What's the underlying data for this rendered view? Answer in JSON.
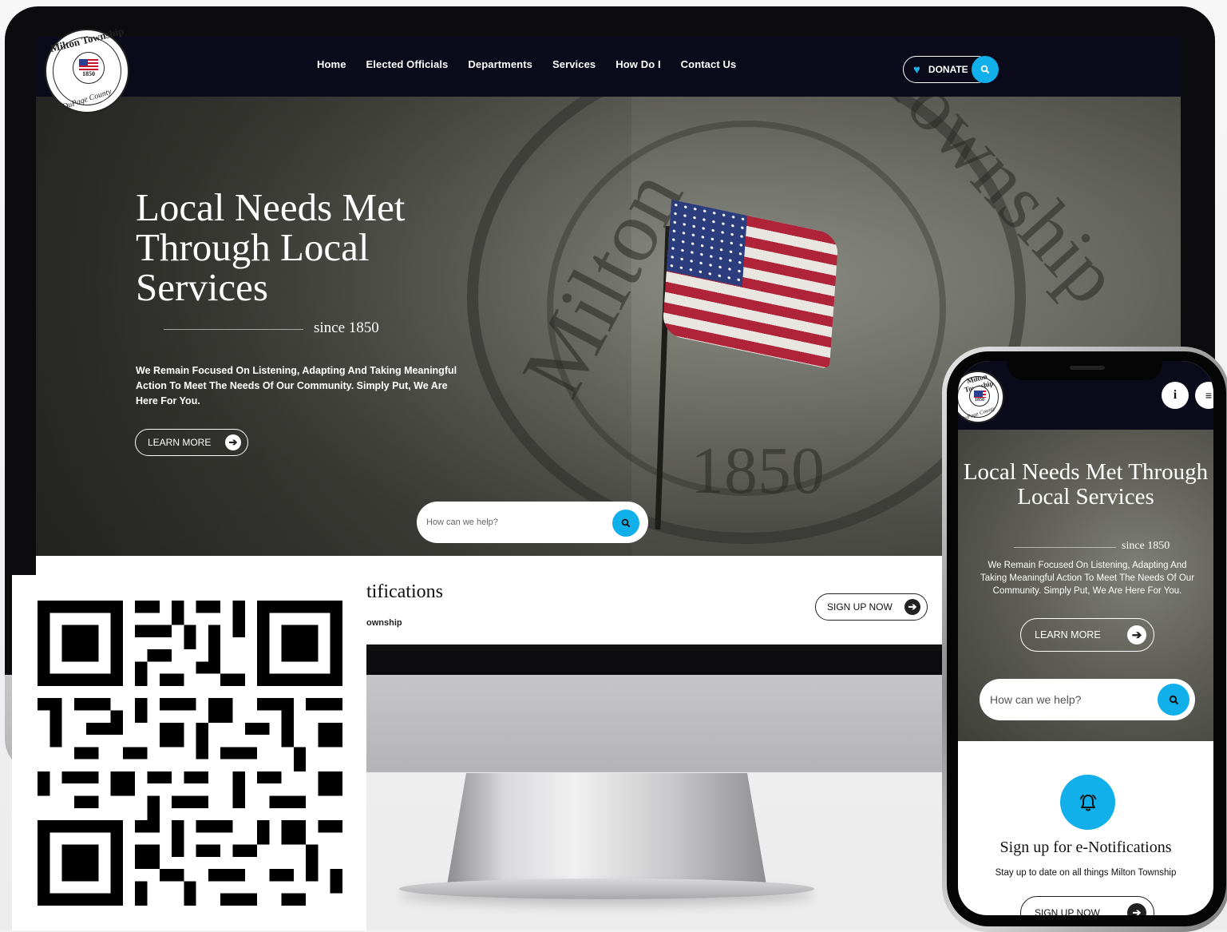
{
  "site": {
    "seal": {
      "top_text": "Milton Township",
      "bottom_text": "DuPage County",
      "year": "1850"
    },
    "nav": {
      "links": [
        "Home",
        "Elected Officials",
        "Departments",
        "Services",
        "How Do I",
        "Contact Us"
      ],
      "donate_label": "DONATE"
    },
    "hero": {
      "title": "Local Needs Met Through Local Services",
      "since": "since 1850",
      "description": "We Remain Focused On Listening, Adapting And Taking Meaningful Action To Meet The Needs Of Our Community. Simply Put, We Are Here For You.",
      "learn_more": "LEARN MORE",
      "search_placeholder": "How can we help?",
      "background_text": {
        "word1": "Milton",
        "word2": "Township",
        "year": "1850"
      }
    },
    "notifications": {
      "title_partial": "tifications",
      "subtitle_partial": "ownship",
      "signup_label": "SIGN UP NOW"
    }
  },
  "mobile": {
    "hero_title": "Local Needs Met Through Local Services",
    "since": "since 1850",
    "description": "We Remain Focused On Listening, Adapting And Taking Meaningful Action To Meet The Needs Of Our Community. Simply Put, We Are Here For You.",
    "learn_more": "LEARN MORE",
    "search_placeholder": "How can we help?",
    "notif_title": "Sign up for e-Notifications",
    "notif_sub": "Stay up to date on all things Milton Township",
    "signup_label": "SIGN UP NOW"
  },
  "colors": {
    "accent": "#12b0ea",
    "nav_bg": "#0a0a1a",
    "monitor_frame": "#0c0c0e"
  },
  "icons": [
    "heart-icon",
    "search-icon",
    "arrow-right-icon",
    "info-icon",
    "menu-icon",
    "bell-icon",
    "qr-code"
  ]
}
